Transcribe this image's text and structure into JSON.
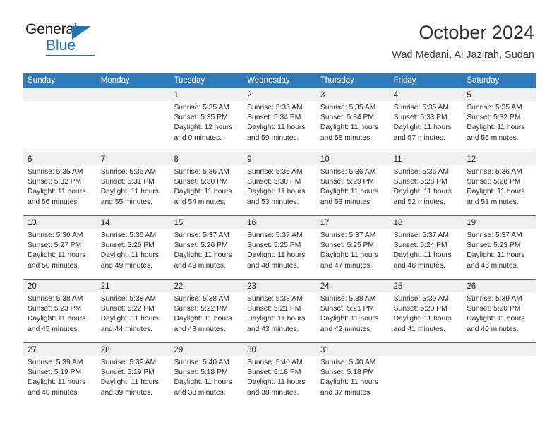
{
  "brand": {
    "name_top": "General",
    "name_bottom": "Blue",
    "accent_color": "#1f74bd",
    "logo_icon": "triangle-icon"
  },
  "header": {
    "title": "October 2024",
    "subtitle": "Wad Medani, Al Jazirah, Sudan"
  },
  "calendar": {
    "header_bg": "#3279b8",
    "row_divider_color": "#2e6da4",
    "day_band_bg": "#f0f0f0",
    "weekdays": [
      "Sunday",
      "Monday",
      "Tuesday",
      "Wednesday",
      "Thursday",
      "Friday",
      "Saturday"
    ],
    "weeks": [
      [
        {
          "day": ""
        },
        {
          "day": ""
        },
        {
          "day": "1",
          "sunrise": "Sunrise: 5:35 AM",
          "sunset": "Sunset: 5:35 PM",
          "daylight1": "Daylight: 12 hours",
          "daylight2": "and 0 minutes."
        },
        {
          "day": "2",
          "sunrise": "Sunrise: 5:35 AM",
          "sunset": "Sunset: 5:34 PM",
          "daylight1": "Daylight: 11 hours",
          "daylight2": "and 59 minutes."
        },
        {
          "day": "3",
          "sunrise": "Sunrise: 5:35 AM",
          "sunset": "Sunset: 5:34 PM",
          "daylight1": "Daylight: 11 hours",
          "daylight2": "and 58 minutes."
        },
        {
          "day": "4",
          "sunrise": "Sunrise: 5:35 AM",
          "sunset": "Sunset: 5:33 PM",
          "daylight1": "Daylight: 11 hours",
          "daylight2": "and 57 minutes."
        },
        {
          "day": "5",
          "sunrise": "Sunrise: 5:35 AM",
          "sunset": "Sunset: 5:32 PM",
          "daylight1": "Daylight: 11 hours",
          "daylight2": "and 56 minutes."
        }
      ],
      [
        {
          "day": "6",
          "sunrise": "Sunrise: 5:35 AM",
          "sunset": "Sunset: 5:32 PM",
          "daylight1": "Daylight: 11 hours",
          "daylight2": "and 56 minutes."
        },
        {
          "day": "7",
          "sunrise": "Sunrise: 5:36 AM",
          "sunset": "Sunset: 5:31 PM",
          "daylight1": "Daylight: 11 hours",
          "daylight2": "and 55 minutes."
        },
        {
          "day": "8",
          "sunrise": "Sunrise: 5:36 AM",
          "sunset": "Sunset: 5:30 PM",
          "daylight1": "Daylight: 11 hours",
          "daylight2": "and 54 minutes."
        },
        {
          "day": "9",
          "sunrise": "Sunrise: 5:36 AM",
          "sunset": "Sunset: 5:30 PM",
          "daylight1": "Daylight: 11 hours",
          "daylight2": "and 53 minutes."
        },
        {
          "day": "10",
          "sunrise": "Sunrise: 5:36 AM",
          "sunset": "Sunset: 5:29 PM",
          "daylight1": "Daylight: 11 hours",
          "daylight2": "and 53 minutes."
        },
        {
          "day": "11",
          "sunrise": "Sunrise: 5:36 AM",
          "sunset": "Sunset: 5:28 PM",
          "daylight1": "Daylight: 11 hours",
          "daylight2": "and 52 minutes."
        },
        {
          "day": "12",
          "sunrise": "Sunrise: 5:36 AM",
          "sunset": "Sunset: 5:28 PM",
          "daylight1": "Daylight: 11 hours",
          "daylight2": "and 51 minutes."
        }
      ],
      [
        {
          "day": "13",
          "sunrise": "Sunrise: 5:36 AM",
          "sunset": "Sunset: 5:27 PM",
          "daylight1": "Daylight: 11 hours",
          "daylight2": "and 50 minutes."
        },
        {
          "day": "14",
          "sunrise": "Sunrise: 5:36 AM",
          "sunset": "Sunset: 5:26 PM",
          "daylight1": "Daylight: 11 hours",
          "daylight2": "and 49 minutes."
        },
        {
          "day": "15",
          "sunrise": "Sunrise: 5:37 AM",
          "sunset": "Sunset: 5:26 PM",
          "daylight1": "Daylight: 11 hours",
          "daylight2": "and 49 minutes."
        },
        {
          "day": "16",
          "sunrise": "Sunrise: 5:37 AM",
          "sunset": "Sunset: 5:25 PM",
          "daylight1": "Daylight: 11 hours",
          "daylight2": "and 48 minutes."
        },
        {
          "day": "17",
          "sunrise": "Sunrise: 5:37 AM",
          "sunset": "Sunset: 5:25 PM",
          "daylight1": "Daylight: 11 hours",
          "daylight2": "and 47 minutes."
        },
        {
          "day": "18",
          "sunrise": "Sunrise: 5:37 AM",
          "sunset": "Sunset: 5:24 PM",
          "daylight1": "Daylight: 11 hours",
          "daylight2": "and 46 minutes."
        },
        {
          "day": "19",
          "sunrise": "Sunrise: 5:37 AM",
          "sunset": "Sunset: 5:23 PM",
          "daylight1": "Daylight: 11 hours",
          "daylight2": "and 46 minutes."
        }
      ],
      [
        {
          "day": "20",
          "sunrise": "Sunrise: 5:38 AM",
          "sunset": "Sunset: 5:23 PM",
          "daylight1": "Daylight: 11 hours",
          "daylight2": "and 45 minutes."
        },
        {
          "day": "21",
          "sunrise": "Sunrise: 5:38 AM",
          "sunset": "Sunset: 5:22 PM",
          "daylight1": "Daylight: 11 hours",
          "daylight2": "and 44 minutes."
        },
        {
          "day": "22",
          "sunrise": "Sunrise: 5:38 AM",
          "sunset": "Sunset: 5:22 PM",
          "daylight1": "Daylight: 11 hours",
          "daylight2": "and 43 minutes."
        },
        {
          "day": "23",
          "sunrise": "Sunrise: 5:38 AM",
          "sunset": "Sunset: 5:21 PM",
          "daylight1": "Daylight: 11 hours",
          "daylight2": "and 43 minutes."
        },
        {
          "day": "24",
          "sunrise": "Sunrise: 5:38 AM",
          "sunset": "Sunset: 5:21 PM",
          "daylight1": "Daylight: 11 hours",
          "daylight2": "and 42 minutes."
        },
        {
          "day": "25",
          "sunrise": "Sunrise: 5:39 AM",
          "sunset": "Sunset: 5:20 PM",
          "daylight1": "Daylight: 11 hours",
          "daylight2": "and 41 minutes."
        },
        {
          "day": "26",
          "sunrise": "Sunrise: 5:39 AM",
          "sunset": "Sunset: 5:20 PM",
          "daylight1": "Daylight: 11 hours",
          "daylight2": "and 40 minutes."
        }
      ],
      [
        {
          "day": "27",
          "sunrise": "Sunrise: 5:39 AM",
          "sunset": "Sunset: 5:19 PM",
          "daylight1": "Daylight: 11 hours",
          "daylight2": "and 40 minutes."
        },
        {
          "day": "28",
          "sunrise": "Sunrise: 5:39 AM",
          "sunset": "Sunset: 5:19 PM",
          "daylight1": "Daylight: 11 hours",
          "daylight2": "and 39 minutes."
        },
        {
          "day": "29",
          "sunrise": "Sunrise: 5:40 AM",
          "sunset": "Sunset: 5:18 PM",
          "daylight1": "Daylight: 11 hours",
          "daylight2": "and 38 minutes."
        },
        {
          "day": "30",
          "sunrise": "Sunrise: 5:40 AM",
          "sunset": "Sunset: 5:18 PM",
          "daylight1": "Daylight: 11 hours",
          "daylight2": "and 38 minutes."
        },
        {
          "day": "31",
          "sunrise": "Sunrise: 5:40 AM",
          "sunset": "Sunset: 5:18 PM",
          "daylight1": "Daylight: 11 hours",
          "daylight2": "and 37 minutes."
        },
        {
          "day": ""
        },
        {
          "day": ""
        }
      ]
    ]
  }
}
